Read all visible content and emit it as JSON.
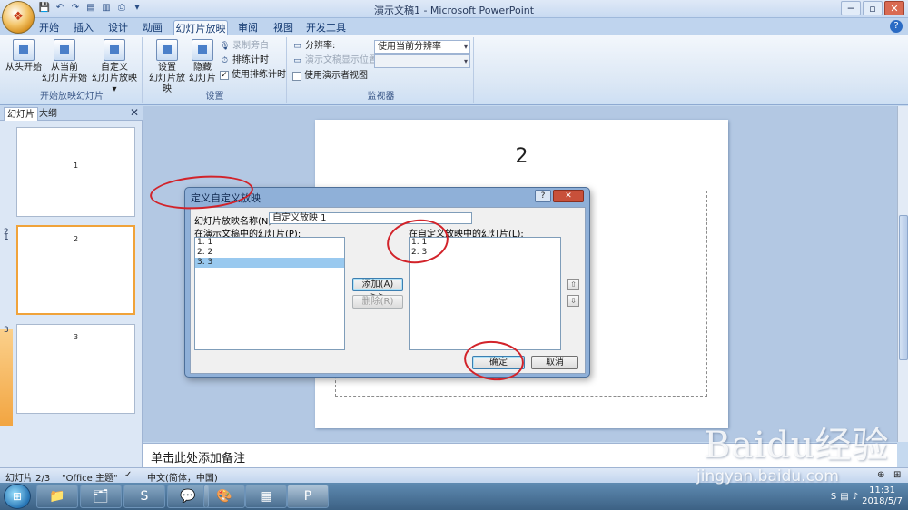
{
  "window": {
    "title": "演示文稿1 - Microsoft PowerPoint",
    "controls": [
      "─",
      "▫",
      "✕"
    ]
  },
  "tabs": [
    "开始",
    "插入",
    "设计",
    "动画",
    "幻灯片放映",
    "审阅",
    "视图",
    "开发工具"
  ],
  "active_tab": "幻灯片放映",
  "ribbon": {
    "start_group": {
      "label": "开始放映幻灯片",
      "from_beginning": "从头开始",
      "from_current_1": "从当前",
      "from_current_2": "幻灯片开始",
      "custom_1": "自定义",
      "custom_2": "幻灯片放映 ▾"
    },
    "setup_group": {
      "label": "设置",
      "setup_1": "设置",
      "setup_2": "幻灯片放映",
      "hide_1": "隐藏",
      "hide_2": "幻灯片",
      "record_narration": "录制旁白",
      "rehearse": "排练计时",
      "use_timings": "使用排练计时"
    },
    "monitor_group": {
      "label": "监视器",
      "resolution_label": "分辨率:",
      "resolution_value": "使用当前分辨率",
      "show_on_label": "演示文稿显示位置:",
      "presenter_view": "使用演示者视图"
    }
  },
  "left_pane": {
    "tab_slides": "幻灯片",
    "tab_outline": "大纲",
    "close": "✕",
    "thumbnails": [
      {
        "num": "1",
        "text": "1"
      },
      {
        "num": "2",
        "text": "2"
      },
      {
        "num": "3",
        "text": "3"
      }
    ]
  },
  "slide": {
    "title": "2"
  },
  "notes_placeholder": "单击此处添加备注",
  "status": {
    "slide_indicator": "幻灯片 2/3",
    "theme": "\"Office 主题\"",
    "language": "中文(简体，中国)",
    "zoom_plus": "⊕"
  },
  "dialog": {
    "title": "定义自定义放映",
    "help": "?",
    "close": "✕",
    "name_label": "幻灯片放映名称(N):",
    "name_value": "自定义放映 1",
    "left_list_label": "在演示文稿中的幻灯片(P):",
    "left_items": [
      "1. 1",
      "2. 2",
      "3. 3"
    ],
    "left_selected_index": 2,
    "right_list_label": "在自定义放映中的幻灯片(L):",
    "right_items": [
      "1. 1",
      "2. 3"
    ],
    "add_button": "添加(A) >>",
    "remove_button": "删除(R)",
    "up_arrow": "⇧",
    "down_arrow": "⇩",
    "ok_button": "确定",
    "cancel_button": "取消"
  },
  "taskbar": {
    "start": "⊞",
    "apps": [
      "📁",
      "🗂",
      "S",
      "💬",
      "🎨",
      "▦",
      "P"
    ],
    "clock_time": "11:31",
    "clock_date": "2018/5/7"
  },
  "watermark": {
    "brand": "Baidu经验",
    "url": "jingyan.baidu.com"
  }
}
